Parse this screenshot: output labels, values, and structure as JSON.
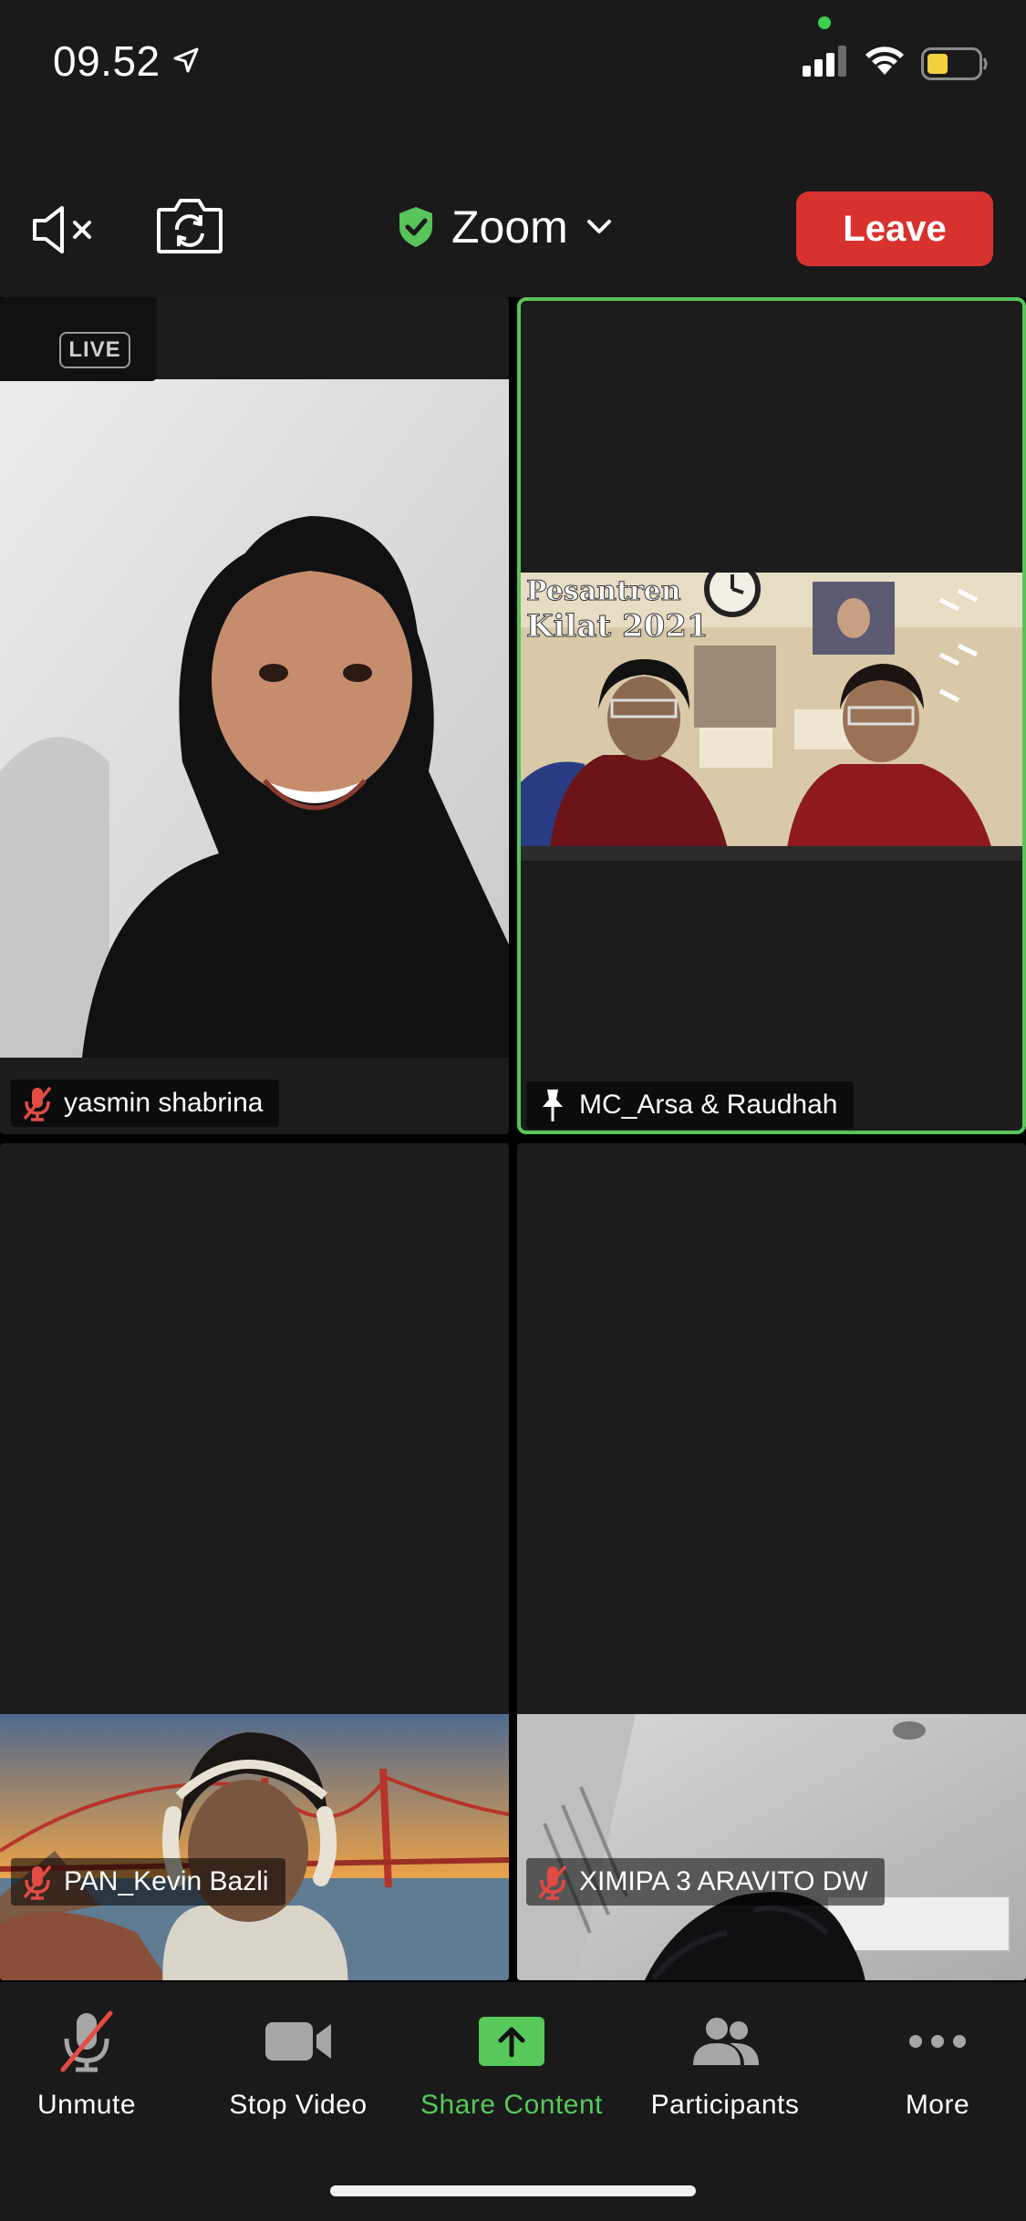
{
  "status_bar": {
    "time": "09.52",
    "icons": [
      "location-arrow-icon",
      "cellular-signal-icon",
      "wifi-icon",
      "battery-icon"
    ],
    "privacy_dot_color": "#3ccf4e",
    "battery_color": "#f4d03f"
  },
  "header": {
    "title": "Zoom",
    "title_icon": "shield-check-icon",
    "speaker_icon": "speaker-muted-icon",
    "camera_icon": "switch-camera-icon",
    "leave_label": "Leave",
    "leave_color": "#d8322f",
    "shield_color": "#58c45a"
  },
  "participants": [
    {
      "name": "yasmin shabrina",
      "status_icon": "mic-muted-icon",
      "live_badge": "LIVE",
      "active_speaker": false
    },
    {
      "name": "MC_Arsa & Raudhah",
      "status_icon": "pin-icon",
      "active_speaker": true,
      "video_text": {
        "line1": "Pesantren",
        "line2": "Kilat 2021"
      }
    },
    {
      "name": "PAN_Kevin Bazli",
      "status_icon": "mic-muted-icon",
      "active_speaker": false
    },
    {
      "name": "XIMIPA 3 ARAVITO DW",
      "status_icon": "mic-muted-icon",
      "active_speaker": false
    }
  ],
  "toolbar": {
    "unmute": "Unmute",
    "stop_video": "Stop Video",
    "share_content": "Share Content",
    "participants": "Participants",
    "more": "More",
    "active_color": "#56c95a"
  }
}
